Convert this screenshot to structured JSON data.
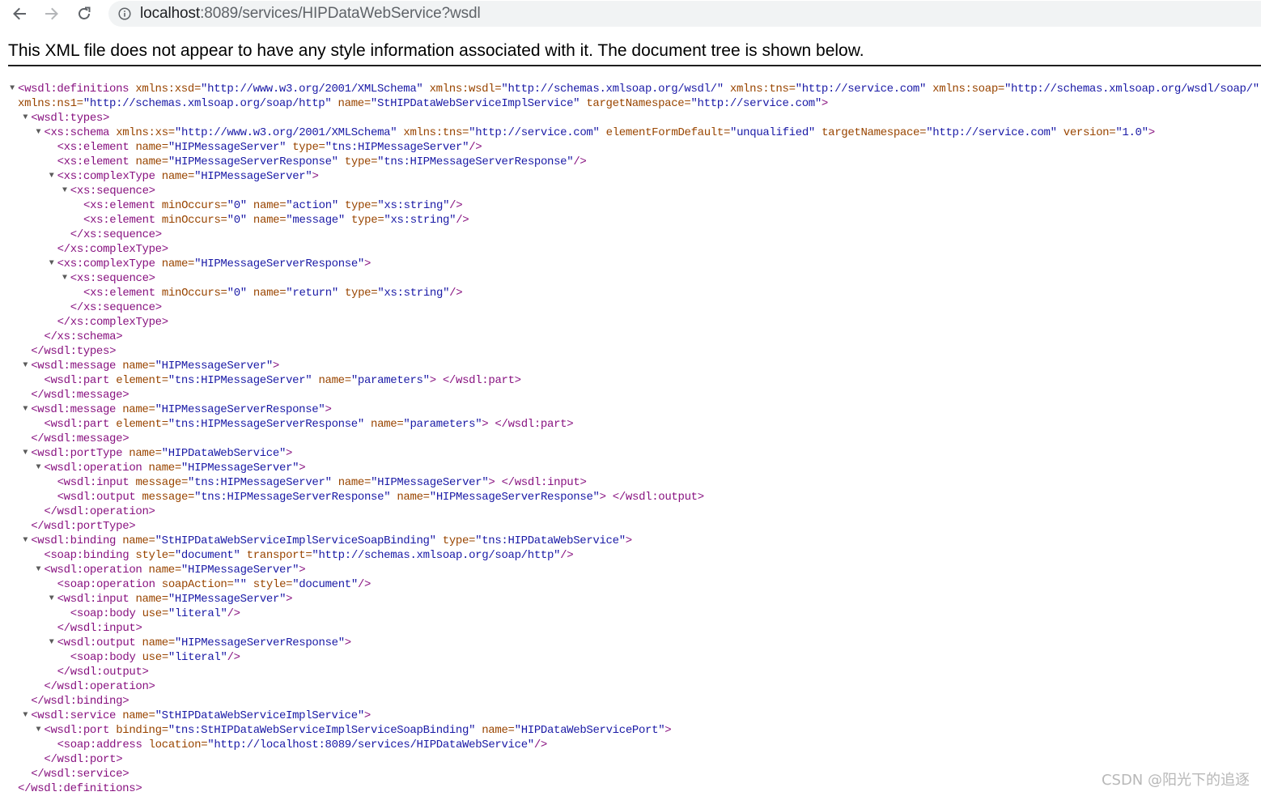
{
  "browser": {
    "url_host": "localhost",
    "url_rest": ":8089/services/HIPDataWebService?wsdl"
  },
  "banner_text": "This XML file does not appear to have any style information associated with it. The document tree is shown below.",
  "watermark": "CSDN @阳光下的追逐",
  "colors": {
    "tag": "#881280",
    "attr_name": "#994500",
    "attr_value": "#1a1aa6"
  },
  "xml_lines": [
    {
      "toggle": true,
      "depth": 0,
      "kind": "open",
      "tag": "wsdl:definitions",
      "attrs": [
        [
          "xmlns:xsd",
          "http://www.w3.org/2001/XMLSchema"
        ],
        [
          "xmlns:wsdl",
          "http://schemas.xmlsoap.org/wsdl/"
        ],
        [
          "xmlns:tns",
          "http://service.com"
        ],
        [
          "xmlns:soap",
          "http://schemas.xmlsoap.org/wsdl/soap/"
        ]
      ],
      "cont": true
    },
    {
      "toggle": false,
      "depth": 0,
      "kind": "contattrs",
      "attrs": [
        [
          "xmlns:ns1",
          "http://schemas.xmlsoap.org/soap/http"
        ],
        [
          "name",
          "StHIPDataWebServiceImplService"
        ],
        [
          "targetNamespace",
          "http://service.com"
        ]
      ],
      "close": ">"
    },
    {
      "toggle": true,
      "depth": 1,
      "kind": "open",
      "tag": "wsdl:types",
      "attrs": []
    },
    {
      "toggle": true,
      "depth": 2,
      "kind": "open",
      "tag": "xs:schema",
      "attrs": [
        [
          "xmlns:xs",
          "http://www.w3.org/2001/XMLSchema"
        ],
        [
          "xmlns:tns",
          "http://service.com"
        ],
        [
          "elementFormDefault",
          "unqualified"
        ],
        [
          "targetNamespace",
          "http://service.com"
        ],
        [
          "version",
          "1.0"
        ]
      ]
    },
    {
      "toggle": false,
      "depth": 3,
      "kind": "self",
      "tag": "xs:element",
      "attrs": [
        [
          "name",
          "HIPMessageServer"
        ],
        [
          "type",
          "tns:HIPMessageServer"
        ]
      ]
    },
    {
      "toggle": false,
      "depth": 3,
      "kind": "self",
      "tag": "xs:element",
      "attrs": [
        [
          "name",
          "HIPMessageServerResponse"
        ],
        [
          "type",
          "tns:HIPMessageServerResponse"
        ]
      ]
    },
    {
      "toggle": true,
      "depth": 3,
      "kind": "open",
      "tag": "xs:complexType",
      "attrs": [
        [
          "name",
          "HIPMessageServer"
        ]
      ]
    },
    {
      "toggle": true,
      "depth": 4,
      "kind": "open",
      "tag": "xs:sequence",
      "attrs": []
    },
    {
      "toggle": false,
      "depth": 5,
      "kind": "self",
      "tag": "xs:element",
      "attrs": [
        [
          "minOccurs",
          "0"
        ],
        [
          "name",
          "action"
        ],
        [
          "type",
          "xs:string"
        ]
      ]
    },
    {
      "toggle": false,
      "depth": 5,
      "kind": "self",
      "tag": "xs:element",
      "attrs": [
        [
          "minOccurs",
          "0"
        ],
        [
          "name",
          "message"
        ],
        [
          "type",
          "xs:string"
        ]
      ]
    },
    {
      "toggle": false,
      "depth": 4,
      "kind": "close",
      "tag": "xs:sequence"
    },
    {
      "toggle": false,
      "depth": 3,
      "kind": "close",
      "tag": "xs:complexType"
    },
    {
      "toggle": true,
      "depth": 3,
      "kind": "open",
      "tag": "xs:complexType",
      "attrs": [
        [
          "name",
          "HIPMessageServerResponse"
        ]
      ]
    },
    {
      "toggle": true,
      "depth": 4,
      "kind": "open",
      "tag": "xs:sequence",
      "attrs": []
    },
    {
      "toggle": false,
      "depth": 5,
      "kind": "self",
      "tag": "xs:element",
      "attrs": [
        [
          "minOccurs",
          "0"
        ],
        [
          "name",
          "return"
        ],
        [
          "type",
          "xs:string"
        ]
      ]
    },
    {
      "toggle": false,
      "depth": 4,
      "kind": "close",
      "tag": "xs:sequence"
    },
    {
      "toggle": false,
      "depth": 3,
      "kind": "close",
      "tag": "xs:complexType"
    },
    {
      "toggle": false,
      "depth": 2,
      "kind": "close",
      "tag": "xs:schema"
    },
    {
      "toggle": false,
      "depth": 1,
      "kind": "close",
      "tag": "wsdl:types"
    },
    {
      "toggle": true,
      "depth": 1,
      "kind": "open",
      "tag": "wsdl:message",
      "attrs": [
        [
          "name",
          "HIPMessageServer"
        ]
      ]
    },
    {
      "toggle": false,
      "depth": 2,
      "kind": "inline",
      "tag": "wsdl:part",
      "attrs": [
        [
          "element",
          "tns:HIPMessageServer"
        ],
        [
          "name",
          "parameters"
        ]
      ]
    },
    {
      "toggle": false,
      "depth": 1,
      "kind": "close",
      "tag": "wsdl:message"
    },
    {
      "toggle": true,
      "depth": 1,
      "kind": "open",
      "tag": "wsdl:message",
      "attrs": [
        [
          "name",
          "HIPMessageServerResponse"
        ]
      ]
    },
    {
      "toggle": false,
      "depth": 2,
      "kind": "inline",
      "tag": "wsdl:part",
      "attrs": [
        [
          "element",
          "tns:HIPMessageServerResponse"
        ],
        [
          "name",
          "parameters"
        ]
      ]
    },
    {
      "toggle": false,
      "depth": 1,
      "kind": "close",
      "tag": "wsdl:message"
    },
    {
      "toggle": true,
      "depth": 1,
      "kind": "open",
      "tag": "wsdl:portType",
      "attrs": [
        [
          "name",
          "HIPDataWebService"
        ]
      ]
    },
    {
      "toggle": true,
      "depth": 2,
      "kind": "open",
      "tag": "wsdl:operation",
      "attrs": [
        [
          "name",
          "HIPMessageServer"
        ]
      ]
    },
    {
      "toggle": false,
      "depth": 3,
      "kind": "inline",
      "tag": "wsdl:input",
      "attrs": [
        [
          "message",
          "tns:HIPMessageServer"
        ],
        [
          "name",
          "HIPMessageServer"
        ]
      ]
    },
    {
      "toggle": false,
      "depth": 3,
      "kind": "inline",
      "tag": "wsdl:output",
      "attrs": [
        [
          "message",
          "tns:HIPMessageServerResponse"
        ],
        [
          "name",
          "HIPMessageServerResponse"
        ]
      ]
    },
    {
      "toggle": false,
      "depth": 2,
      "kind": "close",
      "tag": "wsdl:operation"
    },
    {
      "toggle": false,
      "depth": 1,
      "kind": "close",
      "tag": "wsdl:portType"
    },
    {
      "toggle": true,
      "depth": 1,
      "kind": "open",
      "tag": "wsdl:binding",
      "attrs": [
        [
          "name",
          "StHIPDataWebServiceImplServiceSoapBinding"
        ],
        [
          "type",
          "tns:HIPDataWebService"
        ]
      ]
    },
    {
      "toggle": false,
      "depth": 2,
      "kind": "self",
      "tag": "soap:binding",
      "attrs": [
        [
          "style",
          "document"
        ],
        [
          "transport",
          "http://schemas.xmlsoap.org/soap/http"
        ]
      ]
    },
    {
      "toggle": true,
      "depth": 2,
      "kind": "open",
      "tag": "wsdl:operation",
      "attrs": [
        [
          "name",
          "HIPMessageServer"
        ]
      ]
    },
    {
      "toggle": false,
      "depth": 3,
      "kind": "self",
      "tag": "soap:operation",
      "attrs": [
        [
          "soapAction",
          ""
        ],
        [
          "style",
          "document"
        ]
      ]
    },
    {
      "toggle": true,
      "depth": 3,
      "kind": "open",
      "tag": "wsdl:input",
      "attrs": [
        [
          "name",
          "HIPMessageServer"
        ]
      ]
    },
    {
      "toggle": false,
      "depth": 4,
      "kind": "self",
      "tag": "soap:body",
      "attrs": [
        [
          "use",
          "literal"
        ]
      ]
    },
    {
      "toggle": false,
      "depth": 3,
      "kind": "close",
      "tag": "wsdl:input"
    },
    {
      "toggle": true,
      "depth": 3,
      "kind": "open",
      "tag": "wsdl:output",
      "attrs": [
        [
          "name",
          "HIPMessageServerResponse"
        ]
      ]
    },
    {
      "toggle": false,
      "depth": 4,
      "kind": "self",
      "tag": "soap:body",
      "attrs": [
        [
          "use",
          "literal"
        ]
      ]
    },
    {
      "toggle": false,
      "depth": 3,
      "kind": "close",
      "tag": "wsdl:output"
    },
    {
      "toggle": false,
      "depth": 2,
      "kind": "close",
      "tag": "wsdl:operation"
    },
    {
      "toggle": false,
      "depth": 1,
      "kind": "close",
      "tag": "wsdl:binding"
    },
    {
      "toggle": true,
      "depth": 1,
      "kind": "open",
      "tag": "wsdl:service",
      "attrs": [
        [
          "name",
          "StHIPDataWebServiceImplService"
        ]
      ]
    },
    {
      "toggle": true,
      "depth": 2,
      "kind": "open",
      "tag": "wsdl:port",
      "attrs": [
        [
          "binding",
          "tns:StHIPDataWebServiceImplServiceSoapBinding"
        ],
        [
          "name",
          "HIPDataWebServicePort"
        ]
      ]
    },
    {
      "toggle": false,
      "depth": 3,
      "kind": "self",
      "tag": "soap:address",
      "attrs": [
        [
          "location",
          "http://localhost:8089/services/HIPDataWebService"
        ]
      ]
    },
    {
      "toggle": false,
      "depth": 2,
      "kind": "close",
      "tag": "wsdl:port"
    },
    {
      "toggle": false,
      "depth": 1,
      "kind": "close",
      "tag": "wsdl:service"
    },
    {
      "toggle": false,
      "depth": 0,
      "kind": "close",
      "tag": "wsdl:definitions"
    }
  ]
}
